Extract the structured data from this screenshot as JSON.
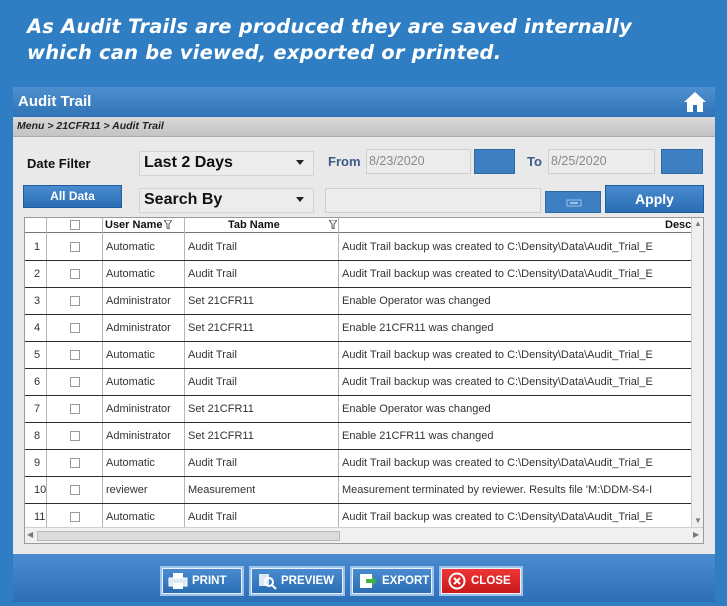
{
  "caption": {
    "line1": "As Audit Trails are produced they are saved internally",
    "line2": "which can be viewed, exported or printed."
  },
  "window": {
    "title": "Audit Trail"
  },
  "breadcrumb": "Menu > 21CFR11 > Audit Trail",
  "filters": {
    "date_filter_label": "Date Filter",
    "date_filter_value": "Last 2 Days",
    "from_label": "From",
    "from_value": "8/23/2020",
    "to_label": "To",
    "to_value": "8/25/2020",
    "all_data_label": "All Data",
    "search_by_value": "Search By",
    "apply_label": "Apply"
  },
  "table": {
    "headers": [
      "User Name",
      "Tab Name",
      "Desc"
    ],
    "rows": [
      {
        "n": "1",
        "user": "Automatic",
        "tab": "Audit Trail",
        "desc": "Audit Trail backup was created to C:\\Density\\Data\\Audit_Trial_E"
      },
      {
        "n": "2",
        "user": "Automatic",
        "tab": "Audit Trail",
        "desc": "Audit Trail backup was created to C:\\Density\\Data\\Audit_Trial_E"
      },
      {
        "n": "3",
        "user": "Administrator",
        "tab": "Set 21CFR11",
        "desc": "Enable Operator was changed"
      },
      {
        "n": "4",
        "user": "Administrator",
        "tab": "Set 21CFR11",
        "desc": "Enable 21CFR11 was changed"
      },
      {
        "n": "5",
        "user": "Automatic",
        "tab": "Audit Trail",
        "desc": "Audit Trail backup was created to C:\\Density\\Data\\Audit_Trial_E"
      },
      {
        "n": "6",
        "user": "Automatic",
        "tab": "Audit Trail",
        "desc": "Audit Trail backup was created to C:\\Density\\Data\\Audit_Trial_E"
      },
      {
        "n": "7",
        "user": "Administrator",
        "tab": "Set 21CFR11",
        "desc": "Enable Operator was changed"
      },
      {
        "n": "8",
        "user": "Administrator",
        "tab": "Set 21CFR11",
        "desc": "Enable 21CFR11 was changed"
      },
      {
        "n": "9",
        "user": "Automatic",
        "tab": "Audit Trail",
        "desc": "Audit Trail backup was created to C:\\Density\\Data\\Audit_Trial_E"
      },
      {
        "n": "10",
        "user": "reviewer",
        "tab": "Measurement",
        "desc": "Measurement terminated by reviewer. Results file 'M:\\DDM-S4-I"
      },
      {
        "n": "11",
        "user": "Automatic",
        "tab": "Audit Trail",
        "desc": "Audit Trail backup was created to C:\\Density\\Data\\Audit_Trial_E"
      }
    ]
  },
  "actions": {
    "print": "PRINT",
    "preview": "PREVIEW",
    "export": "EXPORT",
    "close": "CLOSE"
  },
  "colors": {
    "frame_blue": "#2f7ec4",
    "close_red": "#d92020"
  }
}
